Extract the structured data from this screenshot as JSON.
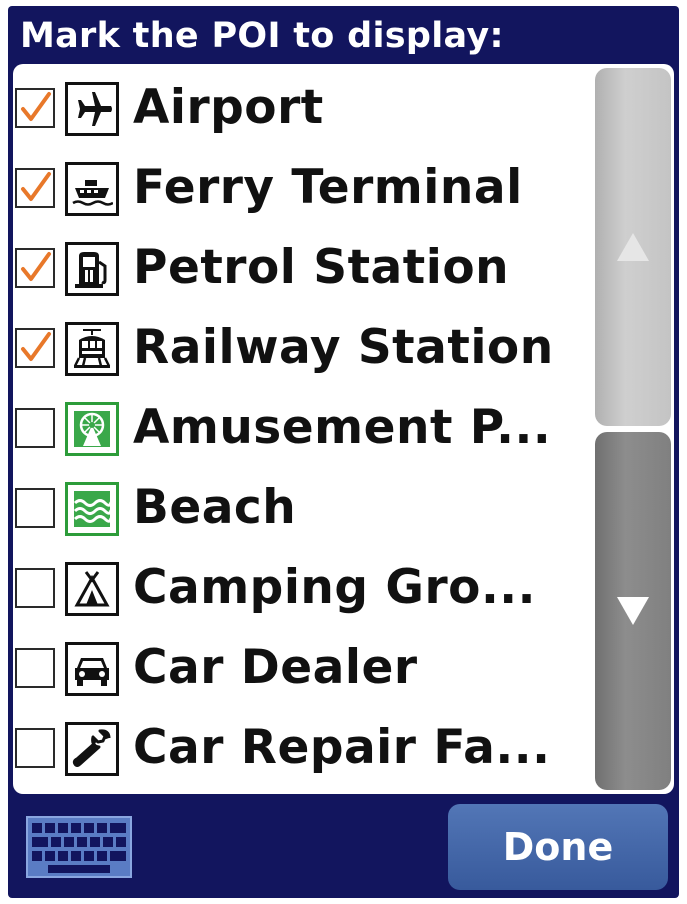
{
  "header": {
    "title": "Mark the POI to display:"
  },
  "poi_list": {
    "items": [
      {
        "label": "Airport",
        "checked": true,
        "icon": "airplane-icon",
        "icon_color": "#111111"
      },
      {
        "label": "Ferry Terminal",
        "checked": true,
        "icon": "ferry-icon",
        "icon_color": "#111111"
      },
      {
        "label": "Petrol Station",
        "checked": true,
        "icon": "fuel-pump-icon",
        "icon_color": "#111111"
      },
      {
        "label": "Railway Station",
        "checked": true,
        "icon": "train-icon",
        "icon_color": "#111111"
      },
      {
        "label": "Amusement P...",
        "checked": false,
        "icon": "amusement-park-icon",
        "icon_color": "#2d9c3a"
      },
      {
        "label": "Beach",
        "checked": false,
        "icon": "waves-icon",
        "icon_color": "#2d9c3a"
      },
      {
        "label": "Camping Gro...",
        "checked": false,
        "icon": "tent-icon",
        "icon_color": "#111111"
      },
      {
        "label": "Car Dealer",
        "checked": false,
        "icon": "car-icon",
        "icon_color": "#111111"
      },
      {
        "label": "Car Repair Fa...",
        "checked": false,
        "icon": "wrench-icon",
        "icon_color": "#111111"
      }
    ]
  },
  "scrollbar": {
    "up_icon": "arrow-up-icon",
    "down_icon": "arrow-down-icon"
  },
  "footer": {
    "keyboard_icon": "keyboard-icon",
    "done_label": "Done"
  },
  "colors": {
    "background": "#12155e",
    "checkmark": "#e8782a",
    "done_button": "#4266a8",
    "green_icon": "#2d9c3a"
  }
}
